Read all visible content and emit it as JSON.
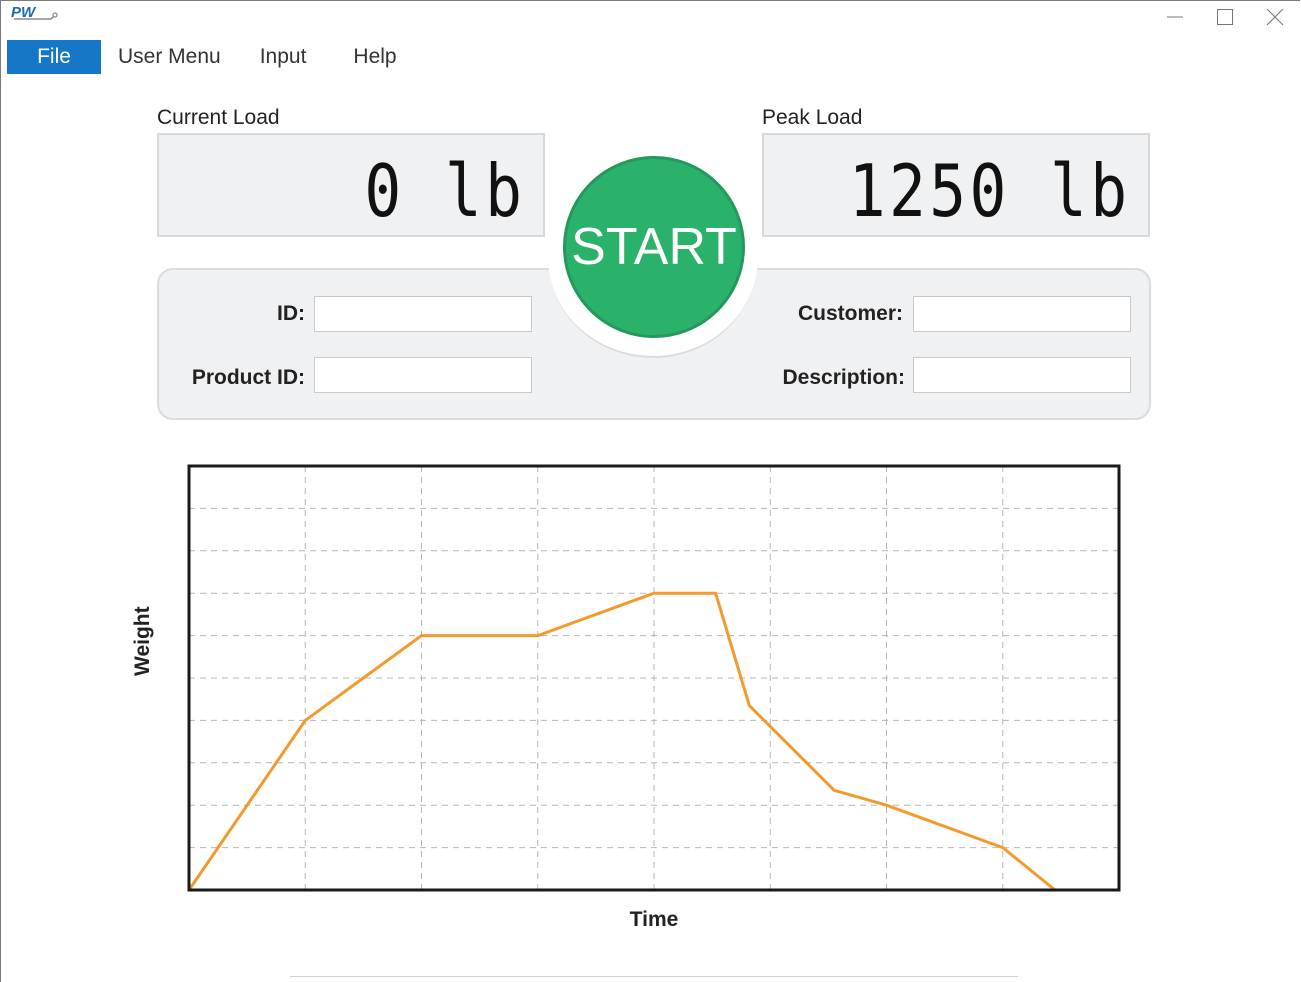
{
  "window": {
    "logo_text": "PW",
    "controls": [
      "minimize",
      "maximize",
      "close"
    ]
  },
  "menu": {
    "file": "File",
    "user_menu": "User Menu",
    "input": "Input",
    "help": "Help"
  },
  "loads": {
    "current_label": "Current Load",
    "current_value": "0 lb",
    "peak_label": "Peak Load",
    "peak_value": "1250 lb"
  },
  "start_label": "START",
  "fields": {
    "id_label": "ID:",
    "id_value": "",
    "product_id_label": "Product ID:",
    "product_id_value": "",
    "customer_label": "Customer:",
    "customer_value": "",
    "description_label": "Description:",
    "description_value": ""
  },
  "colors": {
    "accent": "#1677c8",
    "start": "#2ab26b",
    "line": "#f29a2e",
    "panel": "#f0f1f3"
  },
  "chart_data": {
    "type": "line",
    "xlabel": "Time",
    "ylabel": "Weight",
    "grid": true,
    "xlim": [
      0,
      8
    ],
    "ylim": [
      0,
      10
    ],
    "series": [
      {
        "x": [
          0,
          1,
          2,
          3,
          4,
          4.53,
          4.82,
          5.55,
          6,
          7,
          7.45,
          8
        ],
        "y": [
          0,
          4,
          6,
          6,
          7,
          7,
          4.35,
          2.35,
          2,
          1,
          0,
          0
        ]
      }
    ]
  }
}
